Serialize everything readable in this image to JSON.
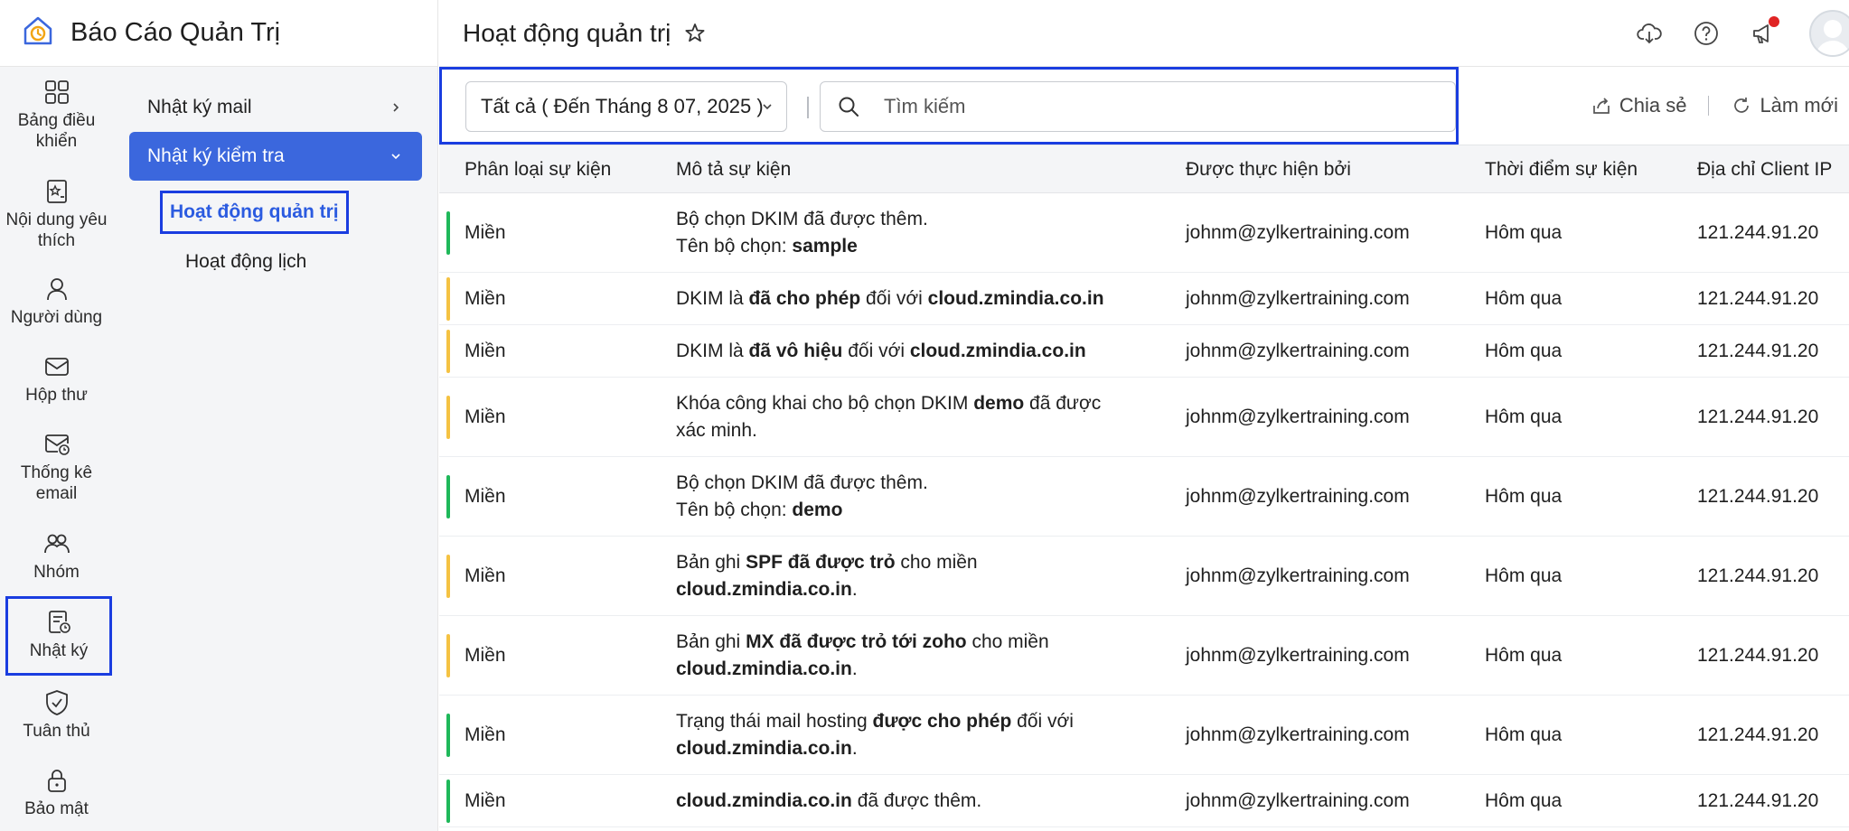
{
  "app": {
    "title": "Báo Cáo Quản Trị",
    "page_title": "Hoạt động quản trị"
  },
  "colors": {
    "accent": "#3b67dd",
    "highlight_box": "#1a3de0",
    "status_green": "#1fb85a",
    "status_yellow": "#f5c242",
    "notification": "#e02424"
  },
  "rail": [
    {
      "label": "Bảng điều khiển",
      "icon": "dashboard-icon"
    },
    {
      "label": "Nội dung yêu thích",
      "icon": "favorites-icon"
    },
    {
      "label": "Người dùng",
      "icon": "user-icon"
    },
    {
      "label": "Hộp thư",
      "icon": "mailbox-icon"
    },
    {
      "label": "Thống kê email",
      "icon": "email-stats-icon"
    },
    {
      "label": "Nhóm",
      "icon": "group-icon"
    },
    {
      "label": "Nhật ký",
      "icon": "log-icon"
    },
    {
      "label": "Tuân thủ",
      "icon": "compliance-icon"
    },
    {
      "label": "Bảo mật",
      "icon": "lock-icon"
    }
  ],
  "subnav": {
    "mail_log": "Nhật ký mail",
    "audit_log": "Nhật ký kiểm tra",
    "admin_activity": "Hoạt động quản trị",
    "calendar_activity": "Hoạt động lịch"
  },
  "toolbar": {
    "date_filter": "Tất cả ( Đến Tháng 8 07, 2025 )",
    "search_placeholder": "Tìm kiếm",
    "share": "Chia sẻ",
    "refresh": "Làm mới"
  },
  "table": {
    "columns": [
      "Phân loại sự kiện",
      "Mô tả sự kiện",
      "Được thực hiện bởi",
      "Thời điểm sự kiện",
      "Địa chỉ Client IP"
    ],
    "rows": [
      {
        "status": "green",
        "type": "Miền",
        "desc": [
          [
            "Bộ chọn DKIM đã được thêm.",
            false
          ]
        ],
        "desc2": [
          [
            "Tên bộ chọn: ",
            false
          ],
          [
            "sample",
            true
          ]
        ],
        "by": "johnm@zylkertraining.com",
        "time": "Hôm qua",
        "ip": "121.244.91.20"
      },
      {
        "status": "yellow",
        "type": "Miền",
        "desc": [
          [
            "DKIM là ",
            false
          ],
          [
            "đã cho phép",
            true
          ],
          [
            " đối với ",
            false
          ],
          [
            "cloud.zmindia.co.in",
            true
          ]
        ],
        "desc2": [],
        "by": "johnm@zylkertraining.com",
        "time": "Hôm qua",
        "ip": "121.244.91.20"
      },
      {
        "status": "yellow",
        "type": "Miền",
        "desc": [
          [
            "DKIM là ",
            false
          ],
          [
            "đã vô hiệu",
            true
          ],
          [
            " đối với ",
            false
          ],
          [
            "cloud.zmindia.co.in",
            true
          ]
        ],
        "desc2": [],
        "by": "johnm@zylkertraining.com",
        "time": "Hôm qua",
        "ip": "121.244.91.20"
      },
      {
        "status": "yellow",
        "type": "Miền",
        "desc": [
          [
            "Khóa công khai cho bộ chọn DKIM ",
            false
          ],
          [
            "demo",
            true
          ],
          [
            " đã được",
            false
          ]
        ],
        "desc2": [
          [
            "xác minh.",
            false
          ]
        ],
        "by": "johnm@zylkertraining.com",
        "time": "Hôm qua",
        "ip": "121.244.91.20"
      },
      {
        "status": "green",
        "type": "Miền",
        "desc": [
          [
            "Bộ chọn DKIM đã được thêm.",
            false
          ]
        ],
        "desc2": [
          [
            "Tên bộ chọn: ",
            false
          ],
          [
            "demo",
            true
          ]
        ],
        "by": "johnm@zylkertraining.com",
        "time": "Hôm qua",
        "ip": "121.244.91.20"
      },
      {
        "status": "yellow",
        "type": "Miền",
        "desc": [
          [
            "Bản ghi ",
            false
          ],
          [
            "SPF đã được trỏ",
            true
          ],
          [
            " cho miền",
            false
          ]
        ],
        "desc2": [
          [
            "cloud.zmindia.co.in",
            true
          ],
          [
            ".",
            false
          ]
        ],
        "by": "johnm@zylkertraining.com",
        "time": "Hôm qua",
        "ip": "121.244.91.20"
      },
      {
        "status": "yellow",
        "type": "Miền",
        "desc": [
          [
            "Bản ghi ",
            false
          ],
          [
            "MX đã được trỏ tới zoho",
            true
          ],
          [
            " cho miền",
            false
          ]
        ],
        "desc2": [
          [
            "cloud.zmindia.co.in",
            true
          ],
          [
            ".",
            false
          ]
        ],
        "by": "johnm@zylkertraining.com",
        "time": "Hôm qua",
        "ip": "121.244.91.20"
      },
      {
        "status": "green",
        "type": "Miền",
        "desc": [
          [
            "Trạng thái mail hosting ",
            false
          ],
          [
            "được cho phép",
            true
          ],
          [
            " đối với",
            false
          ]
        ],
        "desc2": [
          [
            "cloud.zmindia.co.in",
            true
          ],
          [
            ".",
            false
          ]
        ],
        "by": "johnm@zylkertraining.com",
        "time": "Hôm qua",
        "ip": "121.244.91.20"
      },
      {
        "status": "green",
        "type": "Miền",
        "desc": [
          [
            "cloud.zmindia.co.in",
            true
          ],
          [
            " đã được thêm.",
            false
          ]
        ],
        "desc2": [],
        "by": "johnm@zylkertraining.com",
        "time": "Hôm qua",
        "ip": "121.244.91.20"
      }
    ]
  }
}
